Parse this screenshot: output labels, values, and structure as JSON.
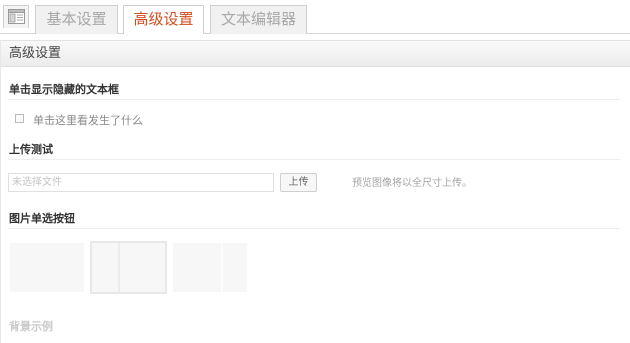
{
  "tabs": [
    {
      "label": "基本设置",
      "active": false
    },
    {
      "label": "高级设置",
      "active": true
    },
    {
      "label": "文本编辑器",
      "active": false
    }
  ],
  "panel": {
    "title": "高级设置"
  },
  "sections": {
    "toggle": {
      "title": "单击显示隐藏的文本框",
      "checkbox_label": "单击这里看发生了什么",
      "checked": false
    },
    "upload": {
      "title": "上传测试",
      "file_placeholder": "未选择文件",
      "button_label": "上传",
      "hint": "预览图像将以全尺寸上传。"
    },
    "image_radio": {
      "title": "图片单选按钮",
      "options": [
        {
          "name": "layout-1",
          "selected": false
        },
        {
          "name": "layout-2",
          "selected": true
        },
        {
          "name": "layout-3",
          "selected": false
        }
      ]
    },
    "background": {
      "title": "背景示例"
    }
  },
  "colors": {
    "accent": "#d54e21",
    "tab_inactive_text": "#a8a8a8"
  }
}
